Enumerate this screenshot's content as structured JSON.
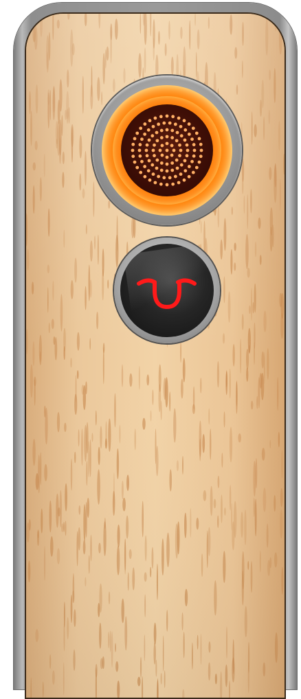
{
  "device": {
    "name": "",
    "body_color": "#e9c79c",
    "frame_color": "#9a9a9a",
    "heater_button": {
      "icon": "heater-dots-icon",
      "glow_color": "#ff7c00",
      "state": "heating"
    },
    "status_button": {
      "icon": "logo-u-icon",
      "led_color": "#ff1a1a"
    }
  }
}
